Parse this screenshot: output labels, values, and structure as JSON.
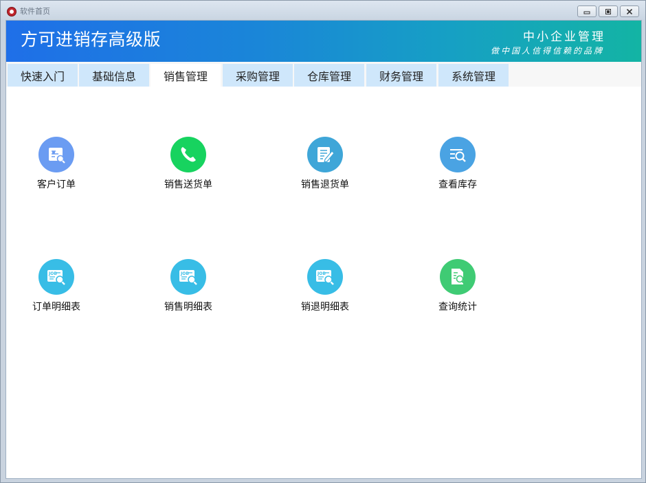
{
  "window": {
    "title": "软件首页"
  },
  "banner": {
    "app_title": "方可进销存高级版",
    "slogan_main": "中小企业管理",
    "slogan_sub": "做中国人信得信赖的品牌"
  },
  "tabs": [
    {
      "label": "快速入门",
      "active": false
    },
    {
      "label": "基础信息",
      "active": false
    },
    {
      "label": "销售管理",
      "active": true
    },
    {
      "label": "采购管理",
      "active": false
    },
    {
      "label": "仓库管理",
      "active": false
    },
    {
      "label": "财务管理",
      "active": false
    },
    {
      "label": "系统管理",
      "active": false
    }
  ],
  "tiles": [
    {
      "label": "客户订单",
      "icon": "customer-order-icon",
      "color": "#6b9cf2"
    },
    {
      "label": "销售送货单",
      "icon": "phone-icon",
      "color": "#17d35f"
    },
    {
      "label": "销售退货单",
      "icon": "edit-document-icon",
      "color": "#3fa6d8"
    },
    {
      "label": "查看库存",
      "icon": "search-list-icon",
      "color": "#4aa3e3"
    },
    {
      "label": "订单明细表",
      "icon": "job-report-icon",
      "color": "#38bde6"
    },
    {
      "label": "销售明细表",
      "icon": "job-report-icon",
      "color": "#38bde6"
    },
    {
      "label": "销退明细表",
      "icon": "job-report-icon",
      "color": "#38bde6"
    },
    {
      "label": "查询统计",
      "icon": "document-search-icon",
      "color": "#3fcb74"
    }
  ]
}
